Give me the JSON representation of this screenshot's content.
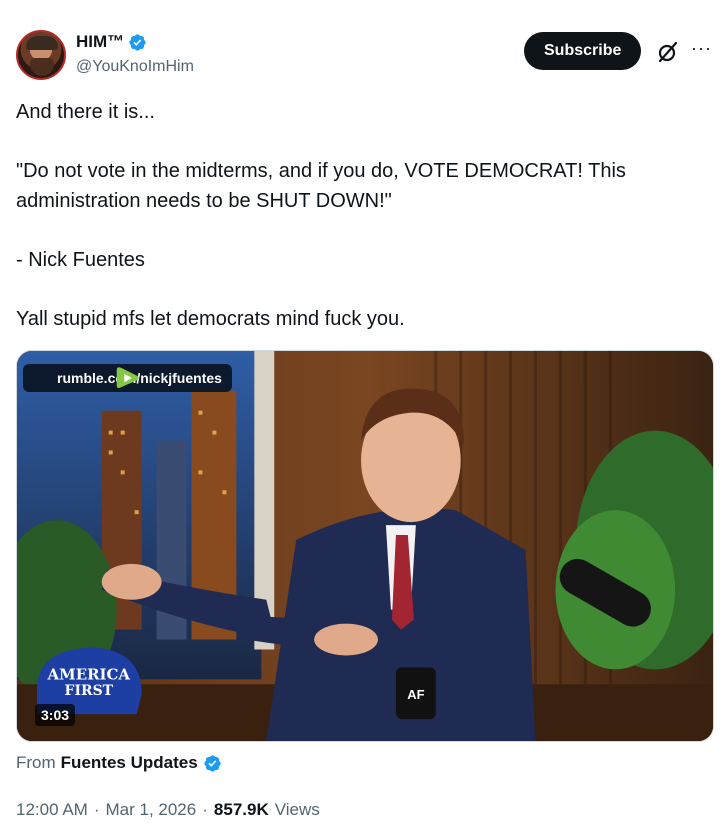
{
  "author": {
    "display_name": "HIM™",
    "handle": "@YouKnoImHim",
    "verified": true,
    "avatar_border_color": "#b72a2a"
  },
  "actions": {
    "subscribe_label": "Subscribe",
    "grok_icon": "grok-icon",
    "more_icon": "more-icon",
    "more_glyph": "···"
  },
  "tweet": {
    "text": "And there it is...\n\n\"Do not vote in the midterms, and if you do, VOTE DEMOCRAT! This administration needs to be SHUT DOWN!\"\n\n- Nick Fuentes\n\nYall stupid mfs let democrats mind fuck you."
  },
  "media": {
    "source_label": "rumble.com/nickjfuentes",
    "duration": "3:03",
    "cap_text": "AMERICA FIRST",
    "mug_text": "AF"
  },
  "attribution": {
    "prefix": "From",
    "source_name": "Fuentes Updates",
    "verified": true
  },
  "meta": {
    "time": "12:00 AM",
    "separator": "·",
    "date": "Mar 1, 2026",
    "views_count": "857.9K",
    "views_label": "Views"
  },
  "colors": {
    "verified_blue": "#1d9bf0",
    "text_primary": "#0f1419",
    "text_secondary": "#536471",
    "rumble_green": "#85c742"
  }
}
